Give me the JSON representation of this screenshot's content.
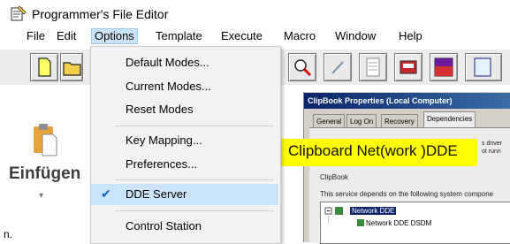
{
  "window": {
    "title": "Programmer's File Editor"
  },
  "menubar": {
    "items": [
      "File",
      "Edit",
      "Options",
      "Template",
      "Execute",
      "Macro",
      "Window",
      "Help"
    ],
    "active": "Options"
  },
  "options_menu": {
    "items": [
      {
        "label": "Default Modes...",
        "checked": false
      },
      {
        "label": "Current Modes...",
        "checked": false
      },
      {
        "label": "Reset Modes",
        "checked": false
      },
      {
        "label": "Key Mapping...",
        "checked": false
      },
      {
        "label": "Preferences...",
        "checked": false
      },
      {
        "label": "DDE Server",
        "checked": true
      },
      {
        "label": "Control Station",
        "checked": false
      }
    ],
    "check_glyph": "✔"
  },
  "left_panel": {
    "paste_label": "Einfügen",
    "arrow": "▾",
    "stray": "n."
  },
  "clipbook": {
    "title": "ClipBook Properties (Local Computer)",
    "tabs": [
      "General",
      "Log On",
      "Recovery",
      "Dependencies"
    ],
    "selected_tab": "Dependencies",
    "service_label": "ClipBook",
    "description": "This service depends on the following system compone",
    "tree": [
      "Network DDE",
      "Network DDE DSDM"
    ],
    "trailing_text": [
      "s driver",
      "ot runn"
    ]
  },
  "highlight": {
    "text": "Clipboard Net(work )DDE",
    "color": "#ffff00"
  },
  "colors": {
    "menu_highlight": "#cce4f7",
    "dialog_title": "#0a246a",
    "dialog_bg": "#d4d0c8"
  },
  "toolbar_icons": [
    "new-file-icon",
    "open-folder-icon",
    "find-icon",
    "edit-icon",
    "notepad-icon",
    "print-icon",
    "ms-dos-icon"
  ]
}
